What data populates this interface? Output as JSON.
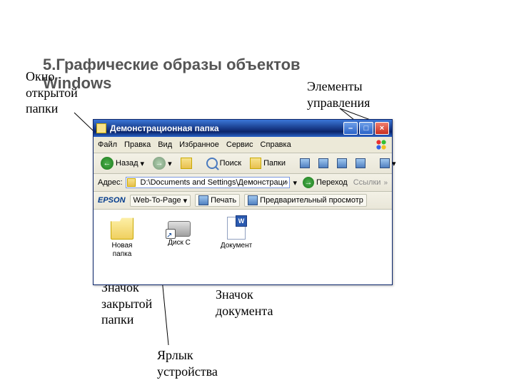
{
  "slide": {
    "title": "5.Графические образы объектов\nWindows"
  },
  "labels": {
    "open_folder_window": "Окно\nоткрытой\nпапки",
    "controls": "Элементы\nуправления",
    "closed_folder_icon": "Значок\nзакрытой\nпапки",
    "document_icon": "Значок\nдокумента",
    "device_shortcut": "Ярлык\nустройства"
  },
  "window": {
    "title": "Демонстрационная папка",
    "menu": [
      "Файл",
      "Правка",
      "Вид",
      "Избранное",
      "Сервис",
      "Справка"
    ],
    "toolbar": {
      "back_label": "Назад",
      "search": "Поиск",
      "folders": "Папки"
    },
    "address": {
      "label": "Адрес:",
      "value": "D:\\Documents and Settings\\Демонстрационная папка",
      "go": "Переход",
      "links": "Ссылки"
    },
    "epson": {
      "brand": "EPSON",
      "webtopage": "Web-To-Page",
      "print": "Печать",
      "preview": "Предварительный просмотр"
    },
    "items": [
      {
        "name": "Новая\nпапка"
      },
      {
        "name": "Диск С"
      },
      {
        "name": "Документ"
      }
    ]
  }
}
